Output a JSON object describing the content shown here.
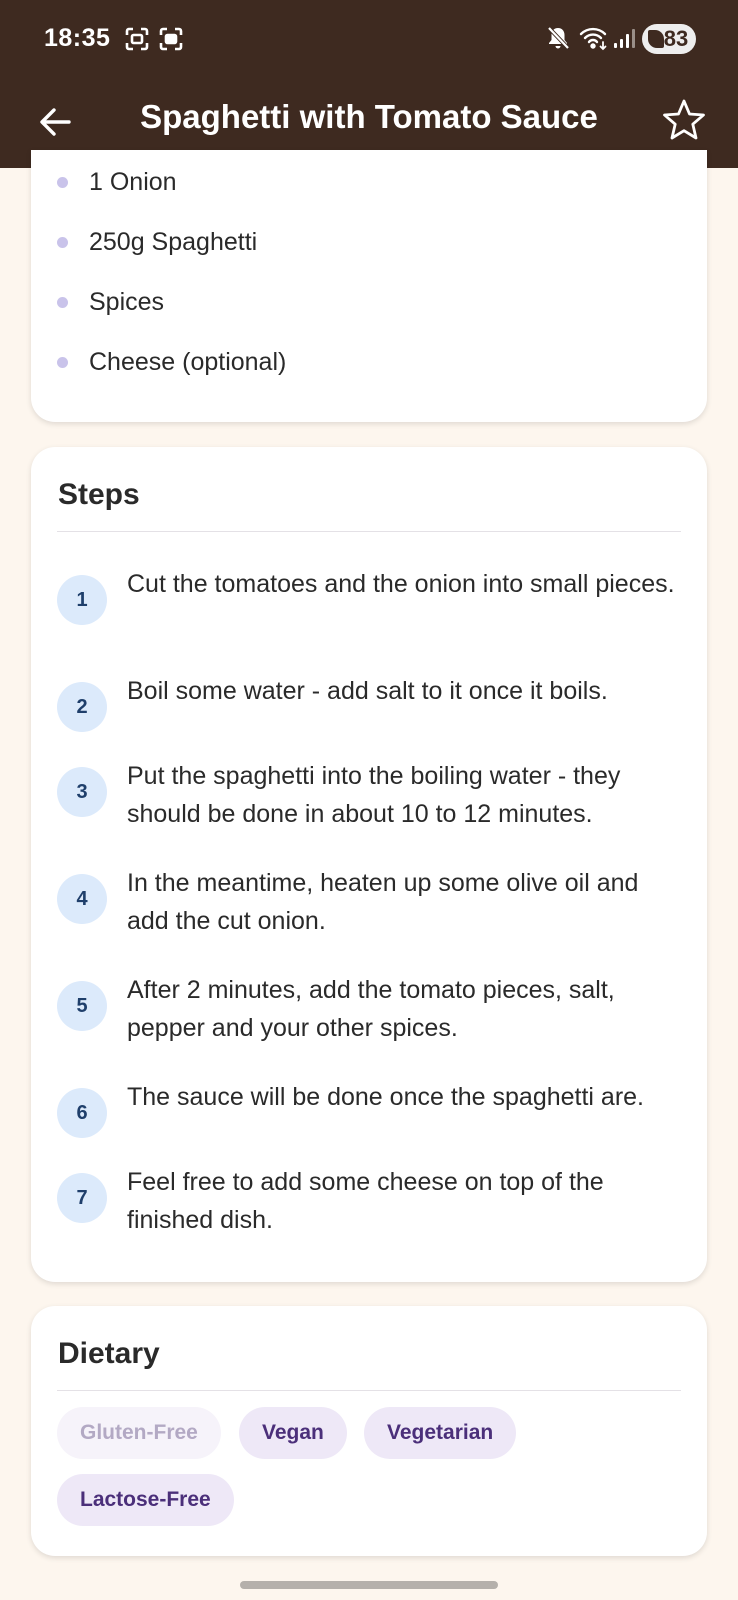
{
  "status_bar": {
    "time": "18:35",
    "battery": "83",
    "icons": [
      "screenshot-icon",
      "screen-record-icon",
      "mute-icon",
      "wifi-icon",
      "signal-icon",
      "battery-saver-icon"
    ]
  },
  "app_bar": {
    "title": "Spaghetti with Tomato Sauce",
    "back_icon": "arrow-left-icon",
    "favorite_icon": "star-outline-icon"
  },
  "ingredients": {
    "items": [
      "1 Onion",
      "250g Spaghetti",
      "Spices",
      "Cheese (optional)"
    ]
  },
  "steps": {
    "title": "Steps",
    "items": [
      {
        "num": "1",
        "text": "Cut the tomatoes and the onion into small pieces."
      },
      {
        "num": "2",
        "text": "Boil some water - add salt to it once it boils."
      },
      {
        "num": "3",
        "text": "Put the spaghetti into the boiling water - they should be done in about 10 to 12 minutes."
      },
      {
        "num": "4",
        "text": "In the meantime, heaten up some olive oil and add the cut onion."
      },
      {
        "num": "5",
        "text": "After 2 minutes, add the tomato pieces, salt, pepper and your other spices."
      },
      {
        "num": "6",
        "text": "The sauce will be done once the spaghetti are."
      },
      {
        "num": "7",
        "text": "Feel free to add some cheese on top of the finished dish."
      }
    ]
  },
  "dietary": {
    "title": "Dietary",
    "tags": [
      {
        "label": "Gluten-Free",
        "active": false
      },
      {
        "label": "Vegan",
        "active": true
      },
      {
        "label": "Vegetarian",
        "active": true
      },
      {
        "label": "Lactose-Free",
        "active": true
      }
    ]
  },
  "colors": {
    "app_bar": "#3E2A20",
    "background": "#FDF6EE",
    "chip_active_bg": "#EEE8F7",
    "chip_active_text": "#4B2F7A",
    "step_badge_bg": "#DCEAFB",
    "bullet": "#C9C3EA"
  }
}
